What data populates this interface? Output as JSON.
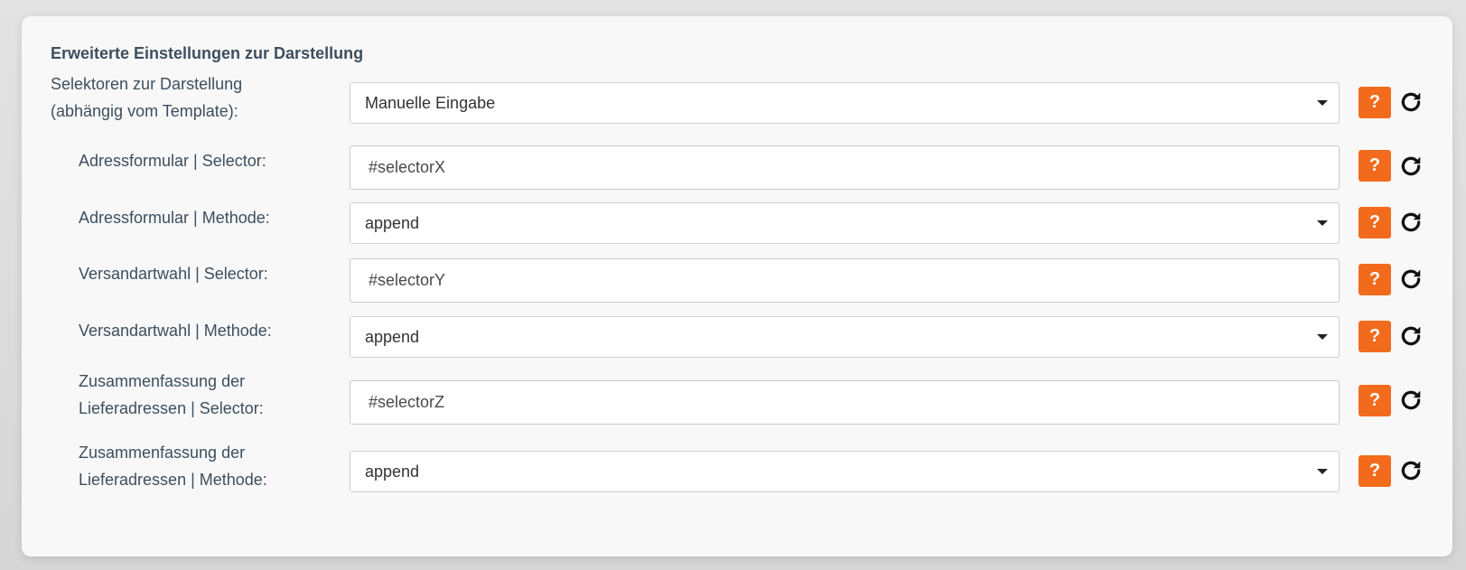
{
  "section": {
    "title": "Erweiterte Einstellungen zur Darstellung"
  },
  "rows": [
    {
      "label_lines": [
        "Selektoren zur Darstellung",
        "(abhängig vom Template):"
      ],
      "type": "select",
      "value": "Manuelle Eingabe"
    },
    {
      "label_lines": [
        "Adressformular | Selector:"
      ],
      "type": "input",
      "value": "#selectorX"
    },
    {
      "label_lines": [
        "Adressformular | Methode:"
      ],
      "type": "select",
      "value": "append"
    },
    {
      "label_lines": [
        "Versandartwahl | Selector:"
      ],
      "type": "input",
      "value": "#selectorY"
    },
    {
      "label_lines": [
        "Versandartwahl | Methode:"
      ],
      "type": "select",
      "value": "append"
    },
    {
      "label_lines": [
        "Zusammenfassung der",
        "Lieferadressen | Selector:"
      ],
      "type": "input",
      "value": "#selectorZ"
    },
    {
      "label_lines": [
        "Zusammenfassung der",
        "Lieferadressen | Methode:"
      ],
      "type": "select",
      "value": "append"
    }
  ],
  "buttons": {
    "help_label": "?",
    "help_icon": "question-icon",
    "reset_icon": "reset-icon"
  },
  "colors": {
    "accent": "#f26b1d",
    "text": "#3d4f5f"
  }
}
